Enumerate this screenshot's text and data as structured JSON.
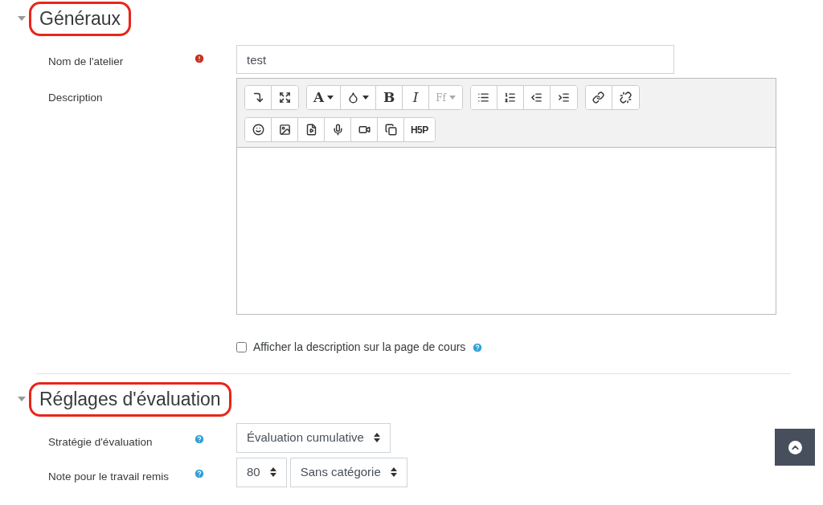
{
  "sections": [
    {
      "title": "Généraux",
      "expanded": true,
      "highlighted": true,
      "fields": [
        {
          "kind": "text",
          "label": "Nom de l'atelier",
          "required": true,
          "help": false,
          "value": "test"
        },
        {
          "kind": "editor",
          "label": "Description",
          "required": false,
          "help": false,
          "toolbar": [
            [
              [
                {
                  "kind": "enter",
                  "disabled": false,
                  "dropdown": false
                },
                {
                  "kind": "fullscreen",
                  "disabled": false,
                  "dropdown": false
                }
              ],
              [
                {
                  "kind": "text",
                  "label": "A",
                  "disabled": false,
                  "dropdown": true
                },
                {
                  "kind": "color",
                  "disabled": false,
                  "dropdown": true
                },
                {
                  "kind": "bold",
                  "label": "B",
                  "disabled": false,
                  "dropdown": false
                },
                {
                  "kind": "italic",
                  "label": "I",
                  "disabled": false,
                  "dropdown": false
                },
                {
                  "kind": "text",
                  "label": "Ff",
                  "disabled": true,
                  "dropdown": true
                }
              ],
              [
                {
                  "kind": "bullets",
                  "disabled": false,
                  "dropdown": false
                },
                {
                  "kind": "numbers",
                  "disabled": false,
                  "dropdown": false
                },
                {
                  "kind": "outdent",
                  "disabled": false,
                  "dropdown": false
                },
                {
                  "kind": "indent",
                  "disabled": false,
                  "dropdown": false
                }
              ],
              [
                {
                  "kind": "link",
                  "disabled": false,
                  "dropdown": false
                },
                {
                  "kind": "unlink",
                  "disabled": false,
                  "dropdown": false
                }
              ]
            ],
            [
              [
                {
                  "kind": "emoji",
                  "disabled": false,
                  "dropdown": false
                },
                {
                  "kind": "image",
                  "disabled": false,
                  "dropdown": false
                },
                {
                  "kind": "media",
                  "disabled": false,
                  "dropdown": false
                },
                {
                  "kind": "audio",
                  "disabled": false,
                  "dropdown": false
                },
                {
                  "kind": "video",
                  "disabled": false,
                  "dropdown": false
                },
                {
                  "kind": "copy",
                  "disabled": false,
                  "dropdown": false
                },
                {
                  "kind": "logo",
                  "label": "H5P",
                  "disabled": false,
                  "dropdown": false
                }
              ]
            ]
          ]
        },
        {
          "kind": "checkbox",
          "label": "Afficher la description sur la page de cours",
          "checked": false,
          "required": false,
          "help": true
        }
      ]
    },
    {
      "title": "Réglages d'évaluation",
      "expanded": true,
      "highlighted": true,
      "fields": [
        {
          "kind": "select",
          "label": "Stratégie d'évaluation",
          "required": false,
          "help": true,
          "selects": [
            "Évaluation cumulative"
          ]
        },
        {
          "kind": "select",
          "label": "Note pour le travail remis",
          "required": false,
          "help": true,
          "selects": [
            "80",
            "Sans catégorie"
          ]
        }
      ]
    }
  ]
}
